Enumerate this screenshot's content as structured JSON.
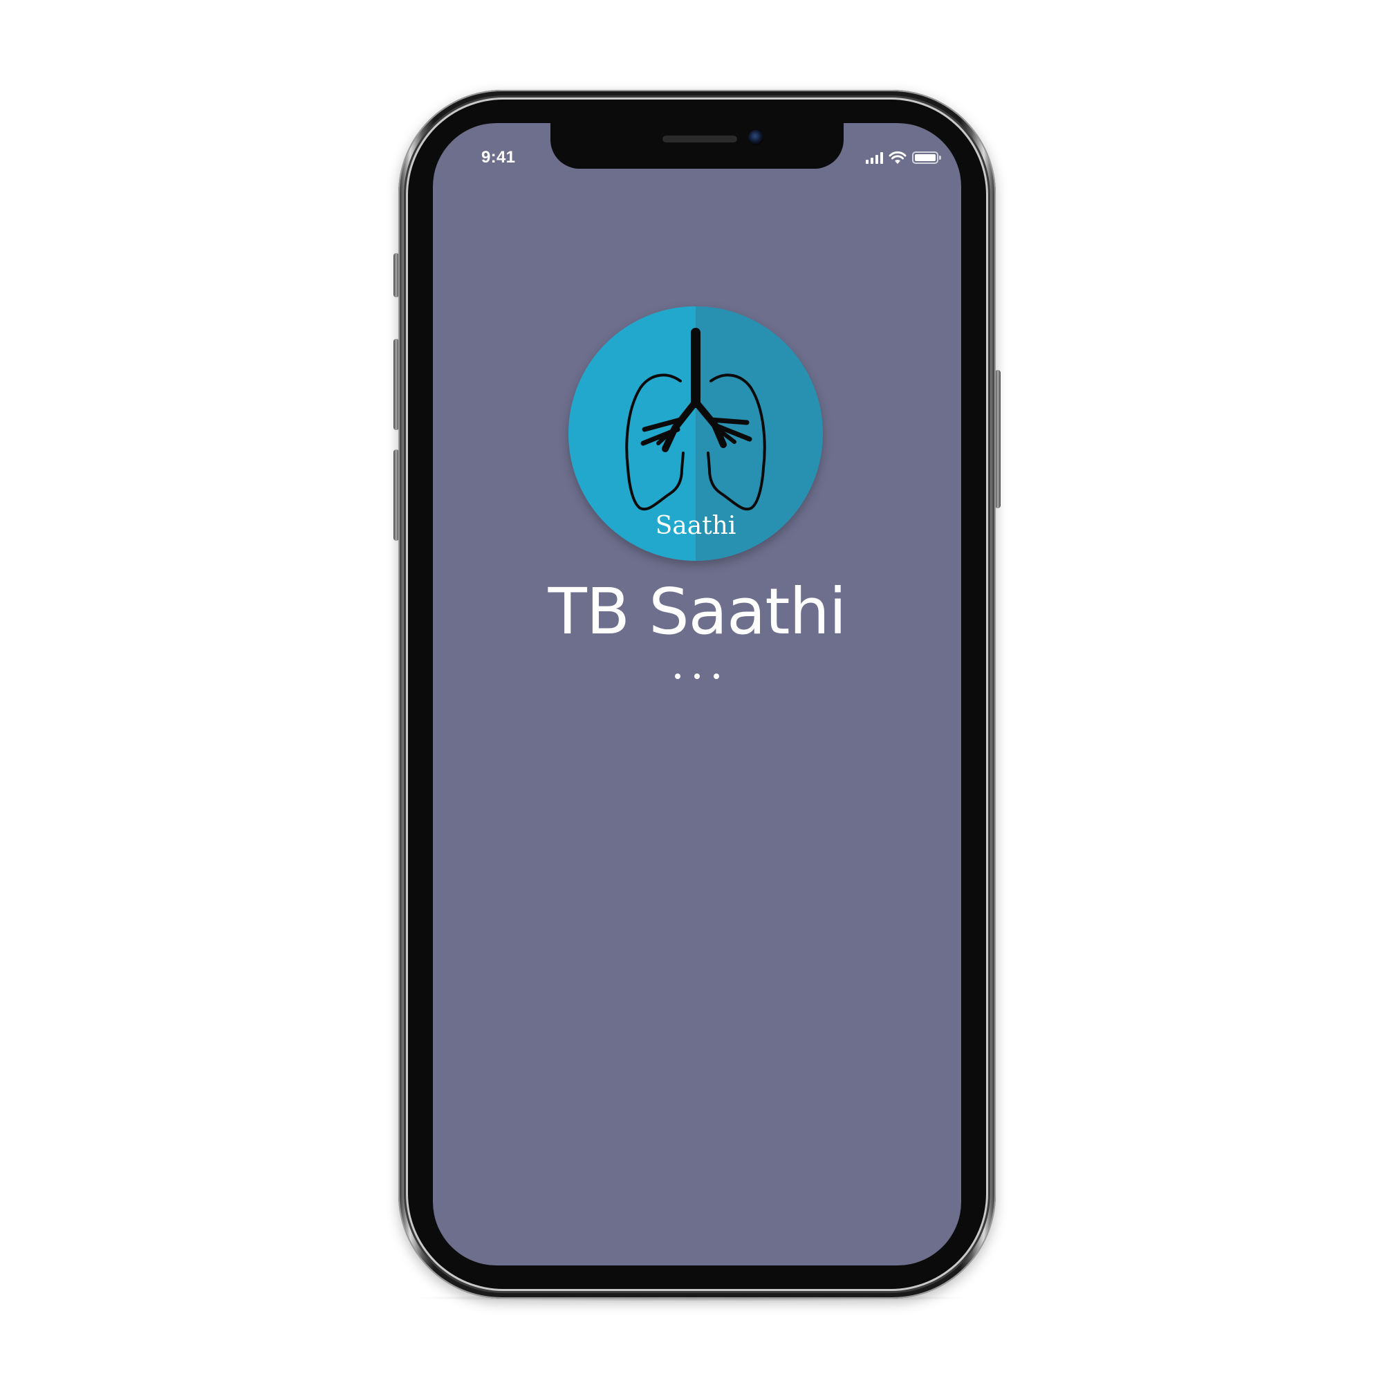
{
  "status_bar": {
    "time": "9:41",
    "icons": [
      "cellular-signal-icon",
      "wifi-icon",
      "battery-icon"
    ],
    "battery_level": 1.0
  },
  "splash": {
    "logo_text": "Saathi",
    "logo_icon": "lungs-icon",
    "app_name": "TB Saathi",
    "loading_indicator": "three-dots"
  },
  "colors": {
    "screen_background": "#6d6f8d",
    "logo_light": "#22a8cc",
    "logo_dark": "#2890b0",
    "text": "#ffffff"
  }
}
